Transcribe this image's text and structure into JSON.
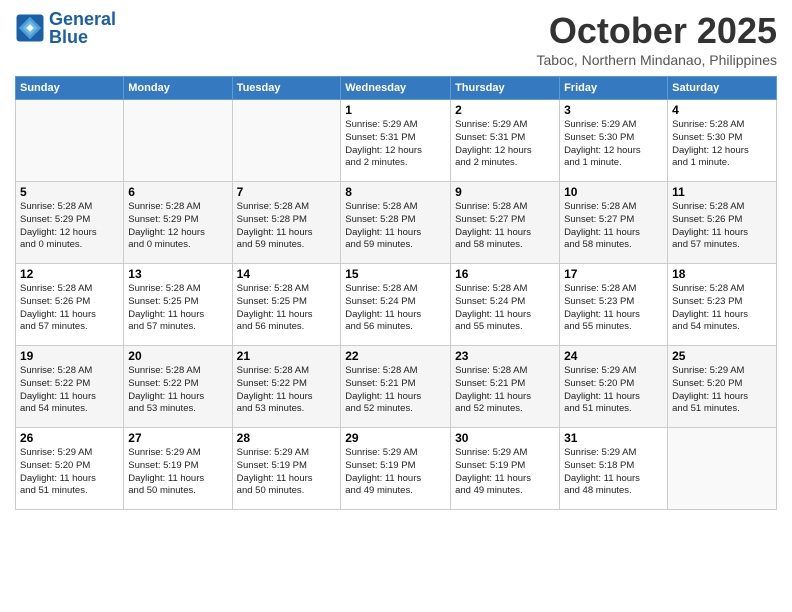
{
  "header": {
    "logo_line1": "General",
    "logo_line2": "Blue",
    "month": "October 2025",
    "location": "Taboc, Northern Mindanao, Philippines"
  },
  "weekdays": [
    "Sunday",
    "Monday",
    "Tuesday",
    "Wednesday",
    "Thursday",
    "Friday",
    "Saturday"
  ],
  "weeks": [
    [
      {
        "day": "",
        "info": ""
      },
      {
        "day": "",
        "info": ""
      },
      {
        "day": "",
        "info": ""
      },
      {
        "day": "1",
        "info": "Sunrise: 5:29 AM\nSunset: 5:31 PM\nDaylight: 12 hours\nand 2 minutes."
      },
      {
        "day": "2",
        "info": "Sunrise: 5:29 AM\nSunset: 5:31 PM\nDaylight: 12 hours\nand 2 minutes."
      },
      {
        "day": "3",
        "info": "Sunrise: 5:29 AM\nSunset: 5:30 PM\nDaylight: 12 hours\nand 1 minute."
      },
      {
        "day": "4",
        "info": "Sunrise: 5:28 AM\nSunset: 5:30 PM\nDaylight: 12 hours\nand 1 minute."
      }
    ],
    [
      {
        "day": "5",
        "info": "Sunrise: 5:28 AM\nSunset: 5:29 PM\nDaylight: 12 hours\nand 0 minutes."
      },
      {
        "day": "6",
        "info": "Sunrise: 5:28 AM\nSunset: 5:29 PM\nDaylight: 12 hours\nand 0 minutes."
      },
      {
        "day": "7",
        "info": "Sunrise: 5:28 AM\nSunset: 5:28 PM\nDaylight: 11 hours\nand 59 minutes."
      },
      {
        "day": "8",
        "info": "Sunrise: 5:28 AM\nSunset: 5:28 PM\nDaylight: 11 hours\nand 59 minutes."
      },
      {
        "day": "9",
        "info": "Sunrise: 5:28 AM\nSunset: 5:27 PM\nDaylight: 11 hours\nand 58 minutes."
      },
      {
        "day": "10",
        "info": "Sunrise: 5:28 AM\nSunset: 5:27 PM\nDaylight: 11 hours\nand 58 minutes."
      },
      {
        "day": "11",
        "info": "Sunrise: 5:28 AM\nSunset: 5:26 PM\nDaylight: 11 hours\nand 57 minutes."
      }
    ],
    [
      {
        "day": "12",
        "info": "Sunrise: 5:28 AM\nSunset: 5:26 PM\nDaylight: 11 hours\nand 57 minutes."
      },
      {
        "day": "13",
        "info": "Sunrise: 5:28 AM\nSunset: 5:25 PM\nDaylight: 11 hours\nand 57 minutes."
      },
      {
        "day": "14",
        "info": "Sunrise: 5:28 AM\nSunset: 5:25 PM\nDaylight: 11 hours\nand 56 minutes."
      },
      {
        "day": "15",
        "info": "Sunrise: 5:28 AM\nSunset: 5:24 PM\nDaylight: 11 hours\nand 56 minutes."
      },
      {
        "day": "16",
        "info": "Sunrise: 5:28 AM\nSunset: 5:24 PM\nDaylight: 11 hours\nand 55 minutes."
      },
      {
        "day": "17",
        "info": "Sunrise: 5:28 AM\nSunset: 5:23 PM\nDaylight: 11 hours\nand 55 minutes."
      },
      {
        "day": "18",
        "info": "Sunrise: 5:28 AM\nSunset: 5:23 PM\nDaylight: 11 hours\nand 54 minutes."
      }
    ],
    [
      {
        "day": "19",
        "info": "Sunrise: 5:28 AM\nSunset: 5:22 PM\nDaylight: 11 hours\nand 54 minutes."
      },
      {
        "day": "20",
        "info": "Sunrise: 5:28 AM\nSunset: 5:22 PM\nDaylight: 11 hours\nand 53 minutes."
      },
      {
        "day": "21",
        "info": "Sunrise: 5:28 AM\nSunset: 5:22 PM\nDaylight: 11 hours\nand 53 minutes."
      },
      {
        "day": "22",
        "info": "Sunrise: 5:28 AM\nSunset: 5:21 PM\nDaylight: 11 hours\nand 52 minutes."
      },
      {
        "day": "23",
        "info": "Sunrise: 5:28 AM\nSunset: 5:21 PM\nDaylight: 11 hours\nand 52 minutes."
      },
      {
        "day": "24",
        "info": "Sunrise: 5:29 AM\nSunset: 5:20 PM\nDaylight: 11 hours\nand 51 minutes."
      },
      {
        "day": "25",
        "info": "Sunrise: 5:29 AM\nSunset: 5:20 PM\nDaylight: 11 hours\nand 51 minutes."
      }
    ],
    [
      {
        "day": "26",
        "info": "Sunrise: 5:29 AM\nSunset: 5:20 PM\nDaylight: 11 hours\nand 51 minutes."
      },
      {
        "day": "27",
        "info": "Sunrise: 5:29 AM\nSunset: 5:19 PM\nDaylight: 11 hours\nand 50 minutes."
      },
      {
        "day": "28",
        "info": "Sunrise: 5:29 AM\nSunset: 5:19 PM\nDaylight: 11 hours\nand 50 minutes."
      },
      {
        "day": "29",
        "info": "Sunrise: 5:29 AM\nSunset: 5:19 PM\nDaylight: 11 hours\nand 49 minutes."
      },
      {
        "day": "30",
        "info": "Sunrise: 5:29 AM\nSunset: 5:19 PM\nDaylight: 11 hours\nand 49 minutes."
      },
      {
        "day": "31",
        "info": "Sunrise: 5:29 AM\nSunset: 5:18 PM\nDaylight: 11 hours\nand 48 minutes."
      },
      {
        "day": "",
        "info": ""
      }
    ]
  ]
}
